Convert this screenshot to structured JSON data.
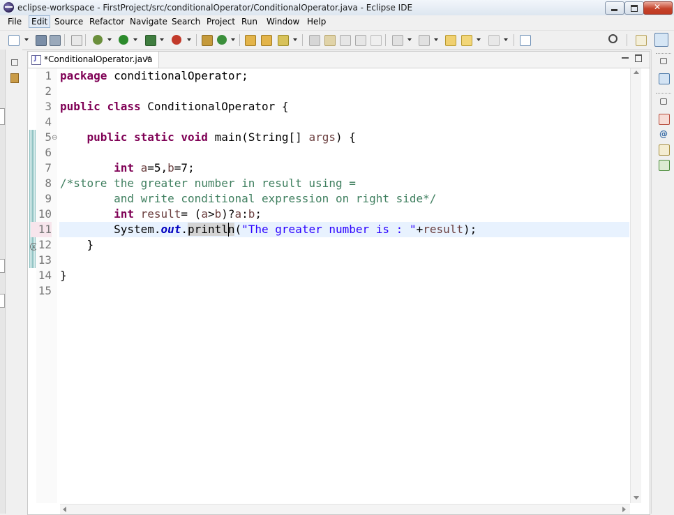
{
  "window": {
    "title": "eclipse-workspace - FirstProject/src/conditionalOperator/ConditionalOperator.java - Eclipse IDE"
  },
  "menu": {
    "items": [
      "File",
      "Edit",
      "Source",
      "Refactor",
      "Navigate",
      "Search",
      "Project",
      "Run",
      "Window",
      "Help"
    ],
    "active": "Edit"
  },
  "editor": {
    "tab_label": "*ConditionalOperator.java",
    "tab_dirty": true,
    "current_line": 11,
    "error_line": 11,
    "line_numbers": [
      "1",
      "2",
      "3",
      "4",
      "5",
      "6",
      "7",
      "8",
      "9",
      "10",
      "11",
      "12",
      "13",
      "14",
      "15"
    ],
    "code": {
      "l1": "package conditionalOperator;",
      "l3": "public class ConditionalOperator {",
      "l5": "    public static void main(String[] args) {",
      "l7": "        int a=5,b=7;",
      "l8": "/*store the greater number in result using =",
      "l9": "        and write conditional expression on right side*/",
      "l10": "        int result= (a>b)?a:b;",
      "l11": "        System.out.println(\"The greater number is : \"+result);",
      "l12": "    }",
      "l14": "}"
    }
  },
  "icons": {
    "toolbar": [
      "new-icon",
      "save-icon",
      "save-all-icon",
      "skip-breakpoints-icon",
      "debug-icon",
      "run-icon",
      "coverage-icon",
      "external-tools-icon",
      "new-java-package-icon",
      "new-java-class-icon",
      "open-type-icon",
      "open-task-icon",
      "search-icon-tb",
      "annotation-icon",
      "mark-occurrences-icon",
      "block-selection-icon",
      "show-whitespace-icon",
      "next-annotation-icon",
      "prev-annotation-icon",
      "last-edit-icon",
      "back-icon",
      "forward-icon",
      "pin-editor-icon",
      "quick-access-search-icon",
      "open-perspective-icon",
      "java-perspective-icon"
    ],
    "colors": {
      "keyword": "#7f0055",
      "comment": "#3f7f5f",
      "string": "#2a00ff",
      "field": "#0000c0",
      "current_line_bg": "#e8f2fe"
    }
  }
}
